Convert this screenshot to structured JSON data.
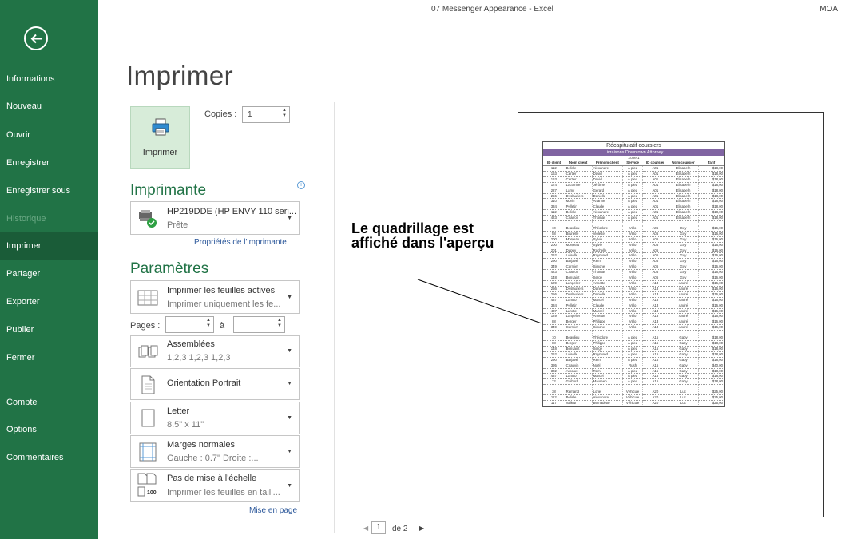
{
  "window": {
    "title": "07 Messenger Appearance - Excel",
    "user": "MOA"
  },
  "sidebar": {
    "items": [
      {
        "label": "Informations"
      },
      {
        "label": "Nouveau"
      },
      {
        "label": "Ouvrir"
      },
      {
        "label": "Enregistrer"
      },
      {
        "label": "Enregistrer sous"
      },
      {
        "label": "Historique"
      },
      {
        "label": "Imprimer"
      },
      {
        "label": "Partager"
      },
      {
        "label": "Exporter"
      },
      {
        "label": "Publier"
      },
      {
        "label": "Fermer"
      },
      {
        "label": "Compte"
      },
      {
        "label": "Options"
      },
      {
        "label": "Commentaires"
      }
    ],
    "active": "Imprimer",
    "disabled": "Historique"
  },
  "page": {
    "title": "Imprimer"
  },
  "print": {
    "button_label": "Imprimer",
    "copies_label": "Copies :",
    "copies_value": "1"
  },
  "printer": {
    "heading": "Imprimante",
    "name": "HP219DDE (HP ENVY 110 seri...",
    "status": "Prête",
    "properties_link": "Propriétés de l'imprimante"
  },
  "settings": {
    "heading": "Paramètres",
    "scope": {
      "line1": "Imprimer les feuilles actives",
      "line2": "Imprimer uniquement les fe..."
    },
    "pages_label": "Pages :",
    "to_label": "à",
    "collate": {
      "line1": "Assemblées",
      "line2": "1,2,3   1,2,3   1,2,3"
    },
    "orientation": {
      "line1": "Orientation Portrait"
    },
    "paper": {
      "line1": "Letter",
      "line2": "8.5\" x 11\""
    },
    "margins": {
      "line1": "Marges normales",
      "line2": "Gauche : 0.7\"     Droite :..."
    },
    "scaling": {
      "line1": "Pas de mise à l'échelle",
      "line2": "Imprimer les feuilles en taill...",
      "icon_text": "100"
    },
    "page_setup_link": "Mise en page"
  },
  "callout": {
    "text": "Le quadrillage est affiché dans l'aperçu"
  },
  "preview": {
    "report_title": "Récapitulatif coursiers",
    "report_subtitle": "Livraisons Downtown Attorney",
    "zone": "Zone 1",
    "columns": [
      "ID client",
      "Nom client",
      "Prénom client",
      "Service",
      "ID coursier",
      "Nom coursier",
      "Tarif"
    ],
    "rows": [
      [
        "112",
        "Belisle",
        "Alexandre",
        "À pied",
        "A01",
        "Elisabeth",
        "$18,00"
      ],
      [
        "163",
        "Cartier",
        "David",
        "À pied",
        "A01",
        "Elisabeth",
        "$18,00"
      ],
      [
        "163",
        "Cartier",
        "David",
        "À pied",
        "A01",
        "Elisabeth",
        "$18,00"
      ],
      [
        "174",
        "Lacombe",
        "Jérôme",
        "À pied",
        "A01",
        "Elisabeth",
        "$18,00"
      ],
      [
        "227",
        "Lamy",
        "Gérard",
        "À pied",
        "A01",
        "Elisabeth",
        "$18,00"
      ],
      [
        "256",
        "Deslauriers",
        "Danielle",
        "À pied",
        "A01",
        "Elisabeth",
        "$18,00"
      ],
      [
        "310",
        "Morin",
        "Arianne",
        "À pied",
        "A01",
        "Elisabeth",
        "$18,00"
      ],
      [
        "334",
        "Pelletin",
        "Claude",
        "À pied",
        "A01",
        "Elisabeth",
        "$18,00"
      ],
      [
        "112",
        "Belisle",
        "Alexandre",
        "À pied",
        "A01",
        "Elisabeth",
        "$18,00"
      ],
      [
        "423",
        "Charron",
        "Thomas",
        "À pied",
        "A01",
        "Elisabeth",
        "$18,00"
      ],
      [
        "",
        "",
        "",
        "",
        "",
        "",
        ""
      ],
      [
        "10",
        "Beaulieu",
        "Théodore",
        "Vélo",
        "A06",
        "Guy",
        "$16,00"
      ],
      [
        "58",
        "Brunelle",
        "Violette",
        "Vélo",
        "A06",
        "Guy",
        "$16,00"
      ],
      [
        "200",
        "Monjeau",
        "Sylvie",
        "Vélo",
        "A06",
        "Guy",
        "$16,00"
      ],
      [
        "200",
        "Monjeau",
        "Sylvie",
        "Vélo",
        "A06",
        "Guy",
        "$16,00"
      ],
      [
        "201",
        "Dupuy",
        "Rachelle",
        "Vélo",
        "A06",
        "Guy",
        "$16,00"
      ],
      [
        "262",
        "Loiselle",
        "Raymond",
        "Vélo",
        "A06",
        "Guy",
        "$16,00"
      ],
      [
        "290",
        "Barjavel",
        "Rémi",
        "Vélo",
        "A06",
        "Guy",
        "$16,00"
      ],
      [
        "349",
        "Cormier",
        "Simone",
        "Vélo",
        "A06",
        "Guy",
        "$16,00"
      ],
      [
        "423",
        "Charron",
        "Thomas",
        "Vélo",
        "A06",
        "Guy",
        "$16,00"
      ],
      [
        "148",
        "Bonsaint",
        "Serge",
        "Vélo",
        "A06",
        "Guy",
        "$16,00"
      ],
      [
        "129",
        "Langelier",
        "Annette",
        "Vélo",
        "A13",
        "André",
        "$16,00"
      ],
      [
        "256",
        "Deslauriers",
        "Danielle",
        "Vélo",
        "A13",
        "André",
        "$16,00"
      ],
      [
        "256",
        "Deslauriers",
        "Danielle",
        "Vélo",
        "A13",
        "André",
        "$16,00"
      ],
      [
        "437",
        "Lanctot",
        "Marcel",
        "Vélo",
        "A13",
        "André",
        "$16,00"
      ],
      [
        "334",
        "Pelletin",
        "Claude",
        "Vélo",
        "A13",
        "André",
        "$16,00"
      ],
      [
        "437",
        "Lanctot",
        "Marcel",
        "Vélo",
        "A13",
        "André",
        "$16,00"
      ],
      [
        "129",
        "Langelier",
        "Annette",
        "Vélo",
        "A13",
        "André",
        "$16,00"
      ],
      [
        "88",
        "Berger",
        "Philippe",
        "Vélo",
        "A13",
        "André",
        "$16,00"
      ],
      [
        "349",
        "Cormier",
        "Simone",
        "Vélo",
        "A13",
        "André",
        "$16,00"
      ],
      [
        "",
        "",
        "",
        "",
        "",
        "",
        ""
      ],
      [
        "10",
        "Beaulieu",
        "Théodore",
        "À pied",
        "A15",
        "Gaby",
        "$18,00"
      ],
      [
        "88",
        "Berger",
        "Philippe",
        "À pied",
        "A15",
        "Gaby",
        "$18,00"
      ],
      [
        "148",
        "Bonsaint",
        "Serge",
        "À pied",
        "A15",
        "Gaby",
        "$18,00"
      ],
      [
        "262",
        "Loiselle",
        "Raymond",
        "À pied",
        "A15",
        "Gaby",
        "$18,00"
      ],
      [
        "290",
        "Barjavel",
        "Rémi",
        "À pied",
        "A15",
        "Gaby",
        "$18,00"
      ],
      [
        "395",
        "Chauvin",
        "Noël",
        "Rush",
        "A15",
        "Gaby",
        "$40,00"
      ],
      [
        "302",
        "Arcouet",
        "Rémi",
        "À pied",
        "A15",
        "Gaby",
        "$18,00"
      ],
      [
        "437",
        "Lanctot",
        "Marcel",
        "À pied",
        "A15",
        "Gaby",
        "$18,00"
      ],
      [
        "72",
        "Guibord",
        "Maureen",
        "À pied",
        "A15",
        "Gaby",
        "$18,00"
      ],
      [
        "",
        "",
        "",
        "",
        "",
        "",
        ""
      ],
      [
        "38",
        "Ramand",
        "Lorie",
        "Véhicule",
        "A20",
        "Luc",
        "$25,00"
      ],
      [
        "112",
        "Belisle",
        "Alexandre",
        "Véhicule",
        "A20",
        "Luc",
        "$25,00"
      ],
      [
        "117",
        "Valleur",
        "Bernadette",
        "Véhicule",
        "A20",
        "Luc",
        "$25,00"
      ]
    ],
    "header_color": "#8064a2"
  },
  "pager": {
    "current": "1",
    "of_text": "de 2"
  },
  "colors": {
    "accent": "#217346",
    "active_nav": "#1a5c38",
    "link": "#2b579a"
  }
}
